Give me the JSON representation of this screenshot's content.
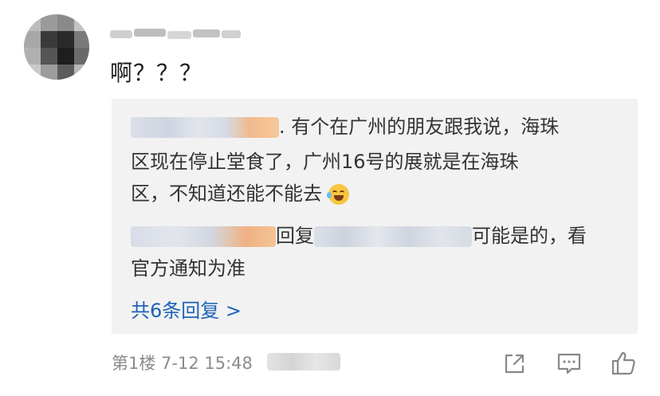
{
  "comment": {
    "text": "啊？？？"
  },
  "replies": {
    "line1": ". 有个在广州的朋友跟我说，海珠",
    "line2": "区现在停止堂食了，广州16号的展就是在海珠",
    "line3": "区，不知道还能不能去",
    "reply_word": "回复",
    "line4": "可能是的，看",
    "line5": "官方通知为准",
    "more_label": "共6条回复 >"
  },
  "footer": {
    "floor_time": "第1楼 7-12 15:48"
  },
  "icons": {
    "share": "share-icon",
    "comment": "comment-icon",
    "like": "thumbs-up-icon"
  },
  "colors": {
    "link": "#1d62b8",
    "meta": "#8c8c8c",
    "reply_bg": "#f2f2f2"
  }
}
